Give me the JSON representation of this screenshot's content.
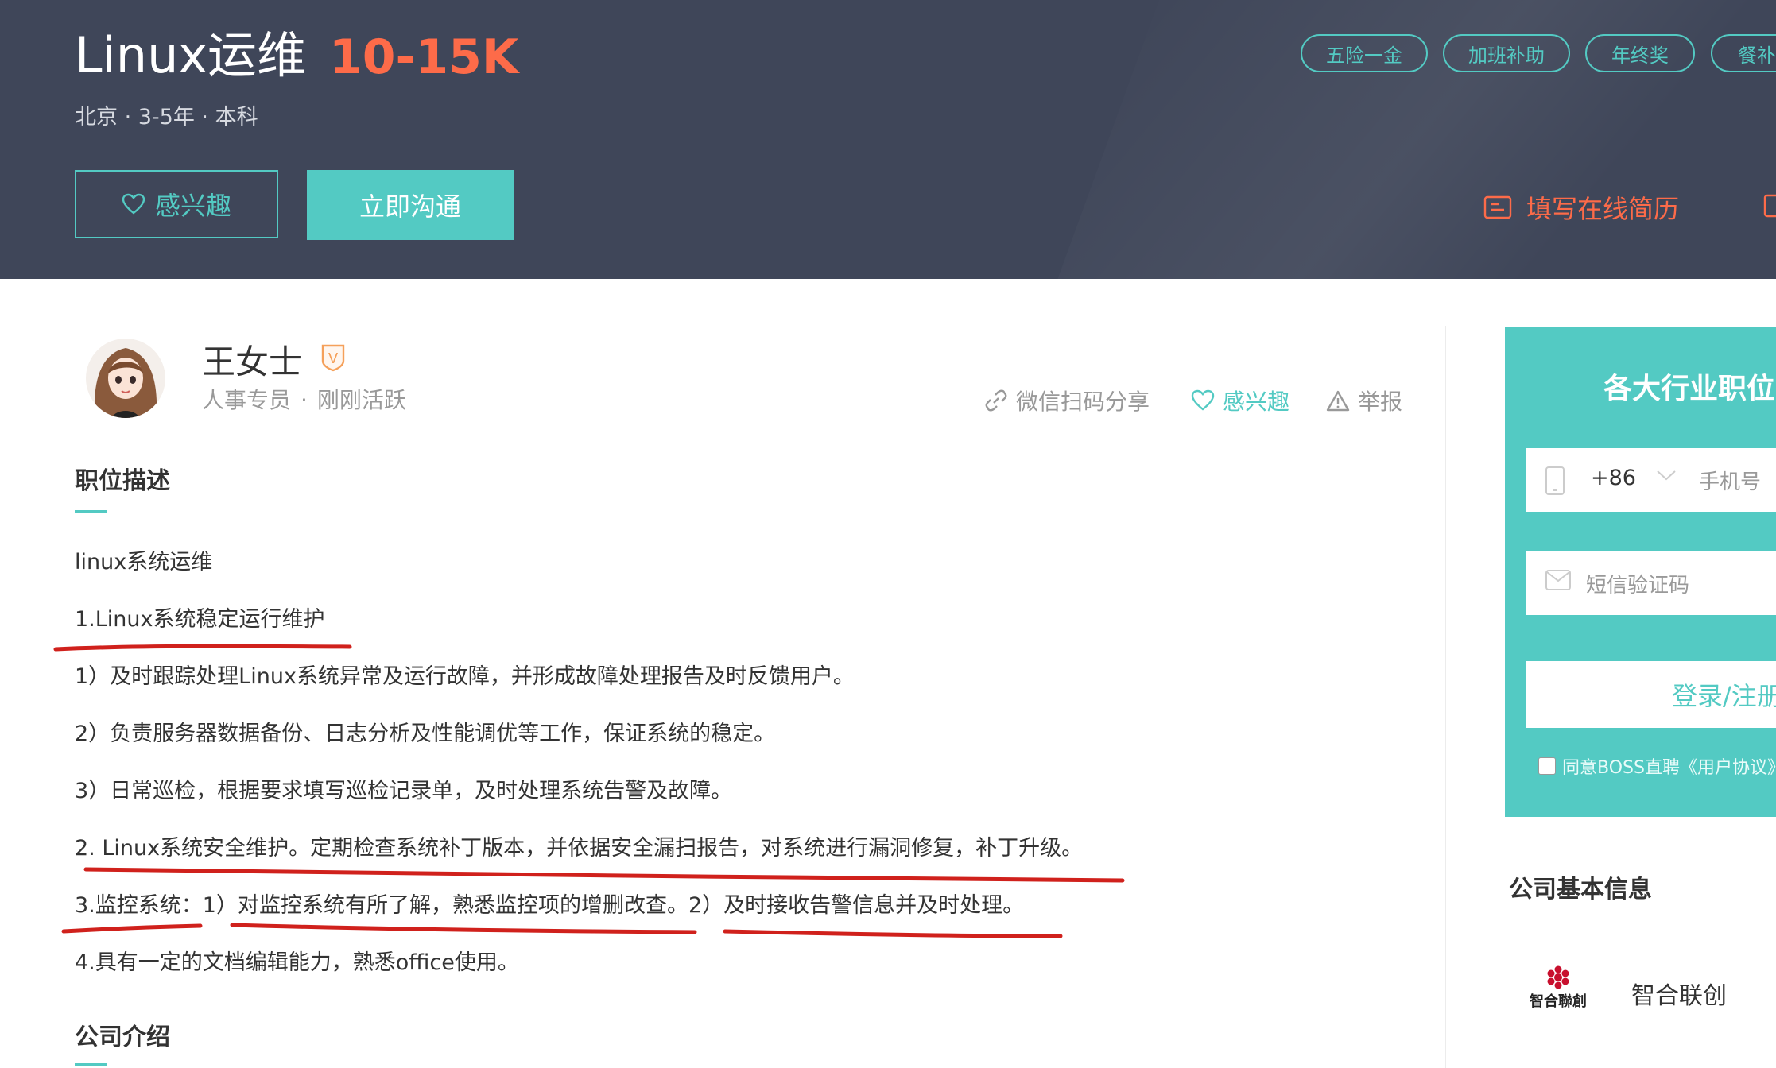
{
  "header": {
    "job_title": "Linux运维",
    "salary": "10-15K",
    "meta": "北京 · 3-5年 · 本科",
    "interest_button": "感兴趣",
    "chat_button": "立即沟通",
    "benefits": [
      "五险一金",
      "加班补助",
      "年终奖",
      "餐补"
    ],
    "resume_link": "填写在线简历"
  },
  "recruiter": {
    "name": "王女士",
    "title": "人事专员",
    "status": "刚刚活跃",
    "badge": "V"
  },
  "actions": {
    "share": "微信扫码分享",
    "interest": "感兴趣",
    "report": "举报"
  },
  "description": {
    "section_title": "职位描述",
    "lines": [
      "linux系统运维",
      "1.Linux系统稳定运行维护",
      "1）及时跟踪处理Linux系统异常及运行故障，并形成故障处理报告及时反馈用户。",
      "2）负责服务器数据备份、日志分析及性能调优等工作，保证系统的稳定。",
      "3）日常巡检，根据要求填写巡检记录单，及时处理系统告警及故障。",
      "2. Linux系统安全维护。定期检查系统补丁版本，并依据安全漏扫报告，对系统进行漏洞修复，补丁升级。",
      "3.监控系统：1）对监控系统有所了解，熟悉监控项的增删改查。2）及时接收告警信息并及时处理。",
      "4.具有一定的文档编辑能力，熟悉office使用。"
    ]
  },
  "company_intro": {
    "section_title": "公司介绍"
  },
  "login_panel": {
    "title": "各大行业职位",
    "country_code": "+86",
    "phone_placeholder": "手机号",
    "sms_placeholder": "短信验证码",
    "login_button": "登录/注册",
    "agreement": "同意BOSS直聘《用户协议》"
  },
  "company_info": {
    "section_title": "公司基本信息",
    "logo_text": "智合聯創",
    "name": "智合联创"
  },
  "colors": {
    "header_bg": "#3f4659",
    "accent": "#53cac3",
    "salary": "#fd6b49",
    "annotation": "#d0211c"
  }
}
